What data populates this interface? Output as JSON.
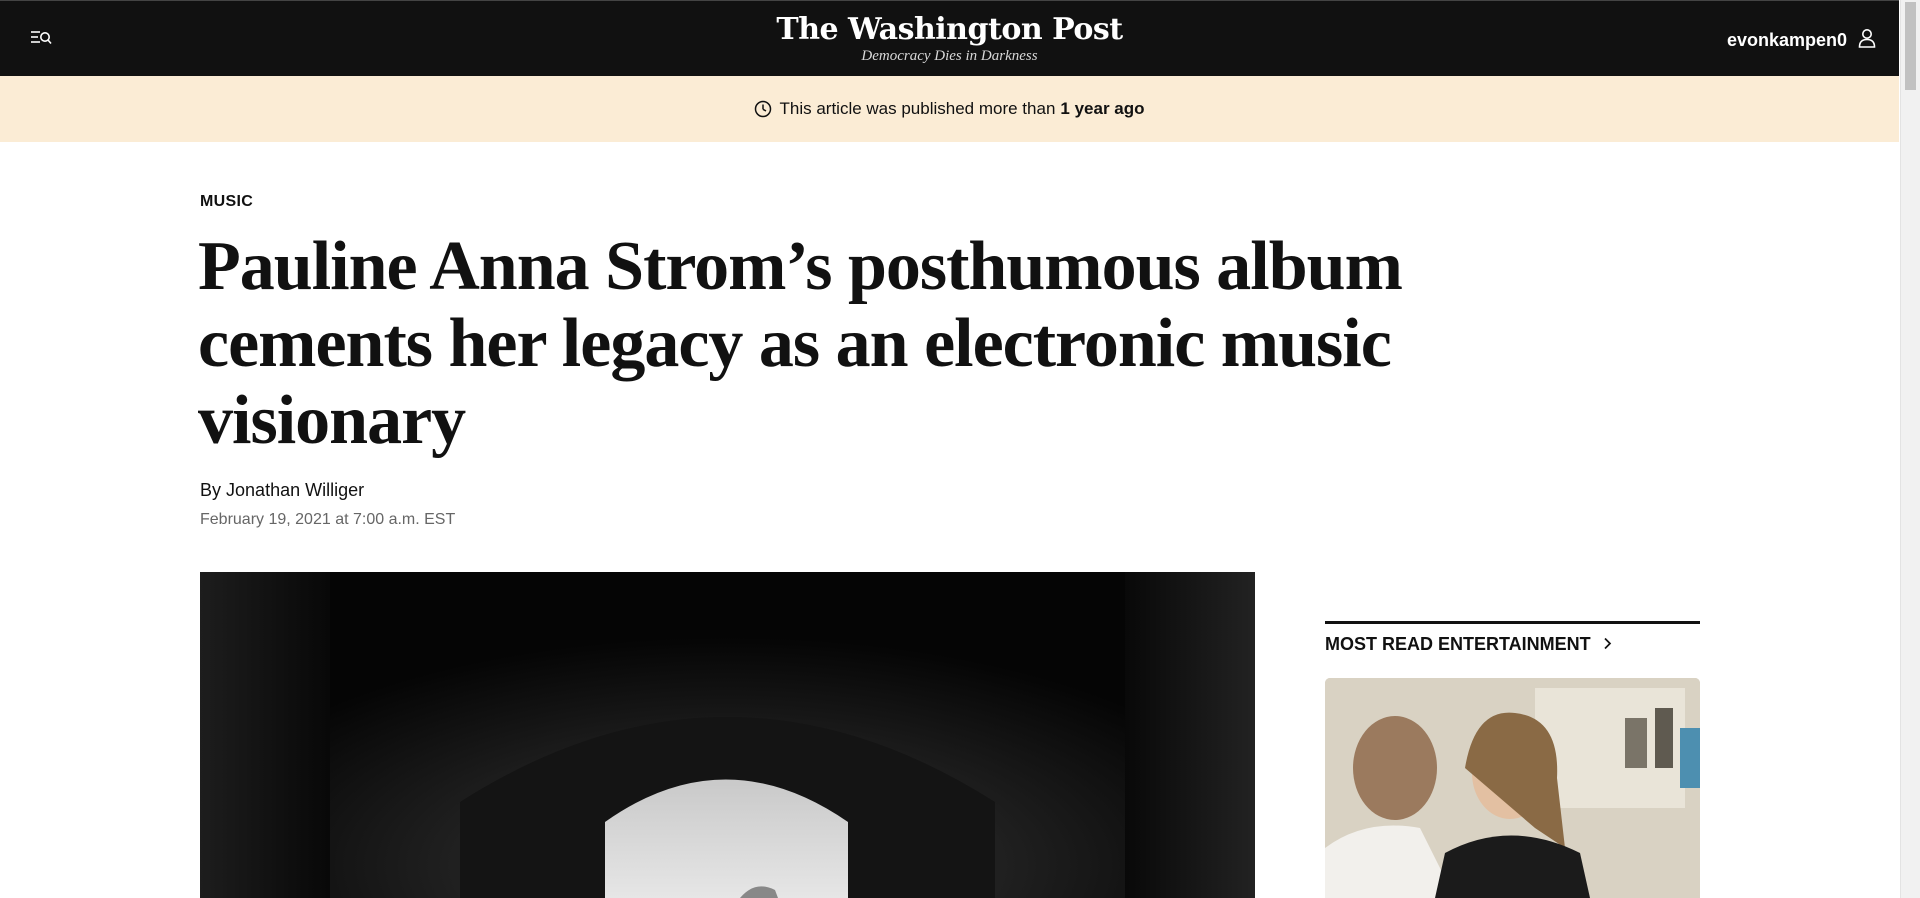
{
  "header": {
    "logo": "The Washington Post",
    "tagline": "Democracy Dies in Darkness",
    "username": "evonkampen0",
    "menu_icon": "menu-search-icon",
    "account_icon": "user-icon",
    "background": "#111111"
  },
  "notice": {
    "text": "This article was published more than",
    "emphasis": "1 year ago",
    "icon": "clock-icon",
    "background": "#fbecd5"
  },
  "article": {
    "section": "MUSIC",
    "headline": "Pauline Anna Strom’s posthumous album cements her legacy as an electronic music visionary",
    "byline_prefix": "By",
    "author": "Jonathan Williger",
    "date": "February 19, 2021 at 7:00 a.m. EST"
  },
  "sidebar": {
    "most_read_title": "MOST READ ENTERTAINMENT",
    "chevron_icon": "chevron-right-icon"
  }
}
